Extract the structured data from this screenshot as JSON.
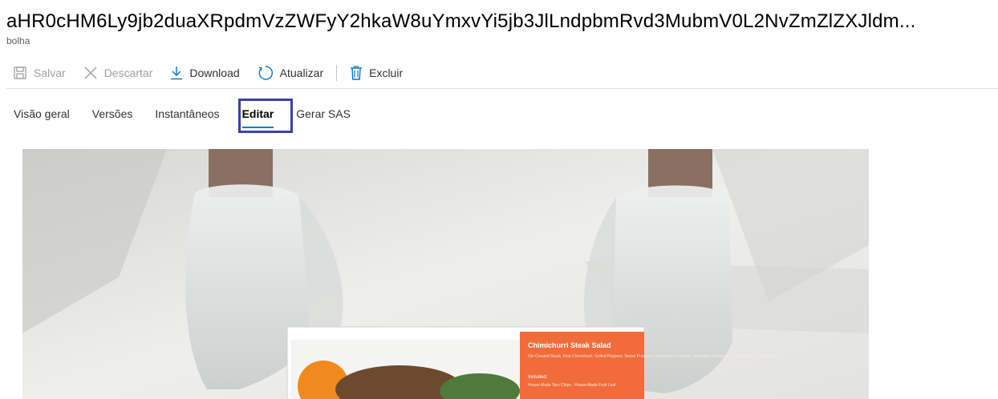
{
  "header": {
    "title": "aHR0cHM6Ly9jb2duaXRpdmVzZWFyY2hkaW8uYmxvYi5jb3JlLndpbmRvd3MubmV0L2NvZmZlZXJldm...",
    "subtitle": "bolha"
  },
  "toolbar": {
    "save_label": "Salvar",
    "discard_label": "Descartar",
    "download_label": "Download",
    "refresh_label": "Atualizar",
    "delete_label": "Excluir"
  },
  "tabs": [
    {
      "label": "Visão geral"
    },
    {
      "label": "Versões"
    },
    {
      "label": "Instantâneos"
    },
    {
      "label": "Editar",
      "active": true
    },
    {
      "label": "Gerar SAS"
    }
  ],
  "image": {
    "box_label_title": "Chimichurri Steak Salad",
    "box_label_text": "Gin Crusted Steak, Feta Chimichurri, Grilled Peppers, Sweet Potatoes, Cornbread Croutons, Marinated Tomatoes + Blue Cheese Dressing",
    "box_label_included": "Included:",
    "box_label_included_items": "House-Made Taro Chips · House-Made Fruit Loaf"
  },
  "colors": {
    "accent": "#0078d4",
    "focus_outline": "#3b3fb3",
    "label_orange": "#f26b3a"
  }
}
